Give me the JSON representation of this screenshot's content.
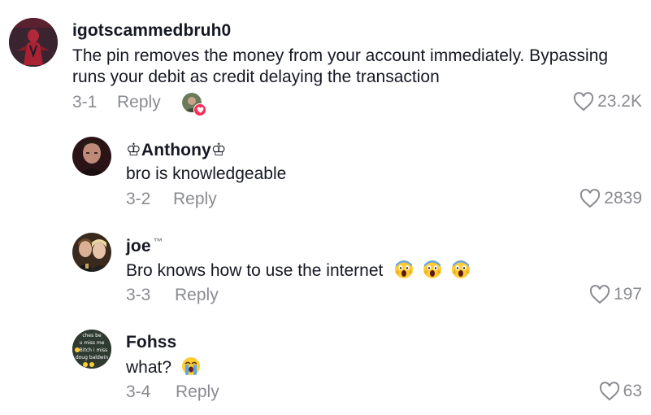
{
  "comments": [
    {
      "username": "igotscammedbruh0",
      "text_line1": "The pin removes the money from your account immediately. Bypassing",
      "text_line2": "runs your debit as credit delaying the transaction",
      "date": "3-1",
      "reply_label": "Reply",
      "likes": "23.2K",
      "liked_by_creator": true
    },
    {
      "username": "♔Anthony♔",
      "text": "bro is knowledgeable",
      "date": "3-2",
      "reply_label": "Reply",
      "likes": "2839"
    },
    {
      "username": "joe",
      "username_suffix": "™",
      "text": "Bro knows how to use the internet",
      "text_emojis": [
        "screaming-face",
        "screaming-face",
        "screaming-face"
      ],
      "date": "3-3",
      "reply_label": "Reply",
      "likes": "197"
    },
    {
      "username": "Fohss",
      "text": "what?",
      "text_emojis": [
        "crying-face"
      ],
      "date": "3-4",
      "reply_label": "Reply",
      "likes": "63",
      "avatar_text": [
        "ches be",
        "u miss me",
        "Bitch i miss",
        "doug baldwin"
      ]
    }
  ],
  "colors": {
    "text": "#161823",
    "meta": "#8a8b91",
    "badge": "#fe2c55"
  },
  "icons": {
    "like": "heart-outline-icon",
    "creator_like_badge": "heart-icon"
  }
}
